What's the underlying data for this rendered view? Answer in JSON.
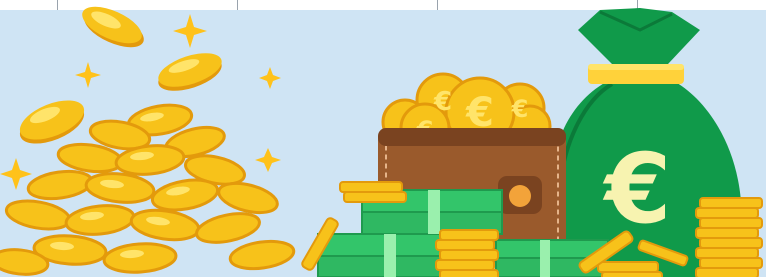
{
  "colors": {
    "background": "#cfe4f4",
    "topbar": "#ffffff",
    "coin_gold": "#f7c21a",
    "coin_highlight": "#ffe46a",
    "coin_shadow": "#e39a0c",
    "bag_green": "#109a4a",
    "bag_dark": "#0b7a39",
    "bag_band": "#ffd23a",
    "euro_glyph": "#f7f3b0",
    "wallet_brown": "#9a5a2c",
    "wallet_dark": "#7a4320",
    "banknote_green": "#33c56a",
    "banknote_light": "#9af0ad",
    "sparkle": "#ffc21a"
  },
  "icons": {
    "sparkle": "four-point-star-icon",
    "coin": "euro-coin-icon",
    "bag": "money-bag-icon",
    "wallet": "wallet-icon",
    "banknote": "banknote-stack-icon"
  },
  "glyphs": {
    "bag_currency": "€",
    "coin_currency": "€"
  }
}
